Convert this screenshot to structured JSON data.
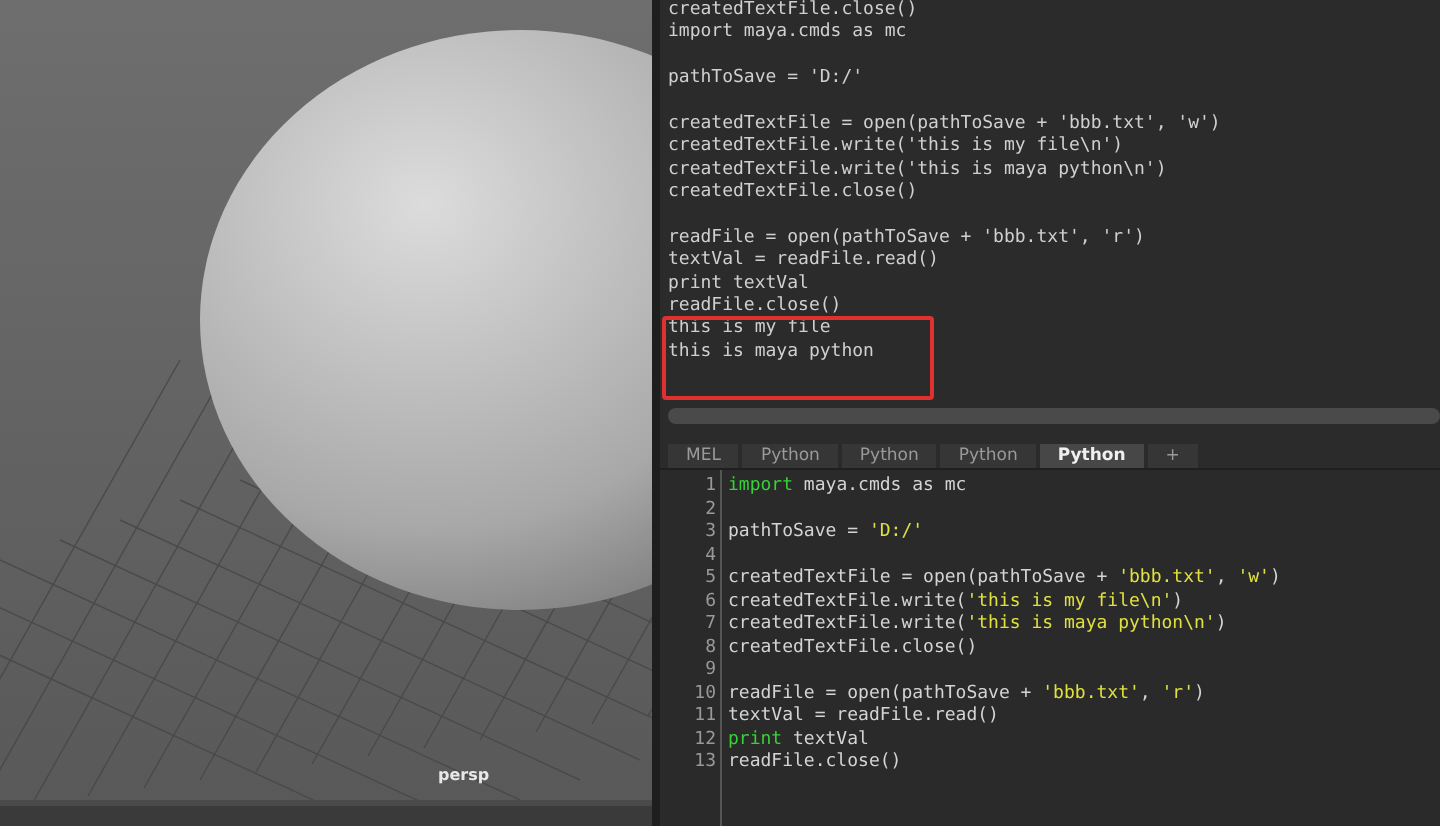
{
  "viewport": {
    "camera_label": "persp"
  },
  "output_lines": [
    {
      "kind": "text",
      "text": "createdTextFile.close()"
    },
    {
      "kind": "text",
      "text": "import maya.cmds as mc"
    },
    {
      "kind": "blank"
    },
    {
      "kind": "text",
      "text": "pathToSave = 'D:/'"
    },
    {
      "kind": "blank"
    },
    {
      "kind": "text",
      "text": "createdTextFile = open(pathToSave + 'bbb.txt', 'w')"
    },
    {
      "kind": "text",
      "text": "createdTextFile.write('this is my file\\n')"
    },
    {
      "kind": "text",
      "text": "createdTextFile.write('this is maya python\\n')"
    },
    {
      "kind": "text",
      "text": "createdTextFile.close()"
    },
    {
      "kind": "blank"
    },
    {
      "kind": "text",
      "text": "readFile = open(pathToSave + 'bbb.txt', 'r')"
    },
    {
      "kind": "text",
      "text": "textVal = readFile.read()"
    },
    {
      "kind": "text",
      "text": "print textVal"
    },
    {
      "kind": "text",
      "text": "readFile.close()"
    },
    {
      "kind": "text",
      "text": "this is my file"
    },
    {
      "kind": "text",
      "text": "this is maya python"
    }
  ],
  "tabs": [
    {
      "label": "MEL",
      "selected": false
    },
    {
      "label": "Python",
      "selected": false
    },
    {
      "label": "Python",
      "selected": false
    },
    {
      "label": "Python",
      "selected": false
    },
    {
      "label": "Python",
      "selected": true
    },
    {
      "label": "+",
      "selected": false
    }
  ],
  "editor_lines": [
    {
      "number": "1",
      "tokens": [
        {
          "kind": "keyword",
          "text": "import"
        },
        {
          "kind": "plain",
          "text": " maya.cmds as mc"
        }
      ]
    },
    {
      "number": "2"
    },
    {
      "number": "3",
      "tokens": [
        {
          "kind": "plain",
          "text": "pathToSave = "
        },
        {
          "kind": "string",
          "text": "'D:/'"
        }
      ]
    },
    {
      "number": "4"
    },
    {
      "number": "5",
      "tokens": [
        {
          "kind": "plain",
          "text": "createdTextFile = open(pathToSave + "
        },
        {
          "kind": "string",
          "text": "'bbb.txt'"
        },
        {
          "kind": "plain",
          "text": ", "
        },
        {
          "kind": "string",
          "text": "'w'"
        },
        {
          "kind": "plain",
          "text": ")"
        }
      ]
    },
    {
      "number": "6",
      "tokens": [
        {
          "kind": "plain",
          "text": "createdTextFile.write("
        },
        {
          "kind": "string",
          "text": "'this is my file\\n'"
        },
        {
          "kind": "plain",
          "text": ")"
        }
      ]
    },
    {
      "number": "7",
      "tokens": [
        {
          "kind": "plain",
          "text": "createdTextFile.write("
        },
        {
          "kind": "string",
          "text": "'this is maya python\\n'"
        },
        {
          "kind": "plain",
          "text": ")"
        }
      ]
    },
    {
      "number": "8",
      "tokens": [
        {
          "kind": "plain",
          "text": "createdTextFile.close()"
        }
      ]
    },
    {
      "number": "9"
    },
    {
      "number": "10",
      "tokens": [
        {
          "kind": "plain",
          "text": "readFile = open(pathToSave + "
        },
        {
          "kind": "string",
          "text": "'bbb.txt'"
        },
        {
          "kind": "plain",
          "text": ", "
        },
        {
          "kind": "string",
          "text": "'r'"
        },
        {
          "kind": "plain",
          "text": ")"
        }
      ]
    },
    {
      "number": "11",
      "tokens": [
        {
          "kind": "plain",
          "text": "textVal = readFile.read()"
        }
      ]
    },
    {
      "number": "12",
      "tokens": [
        {
          "kind": "keyword",
          "text": "print"
        },
        {
          "kind": "plain",
          "text": " textVal"
        }
      ]
    },
    {
      "number": "13",
      "tokens": [
        {
          "kind": "plain",
          "text": "readFile.close()"
        }
      ]
    }
  ]
}
